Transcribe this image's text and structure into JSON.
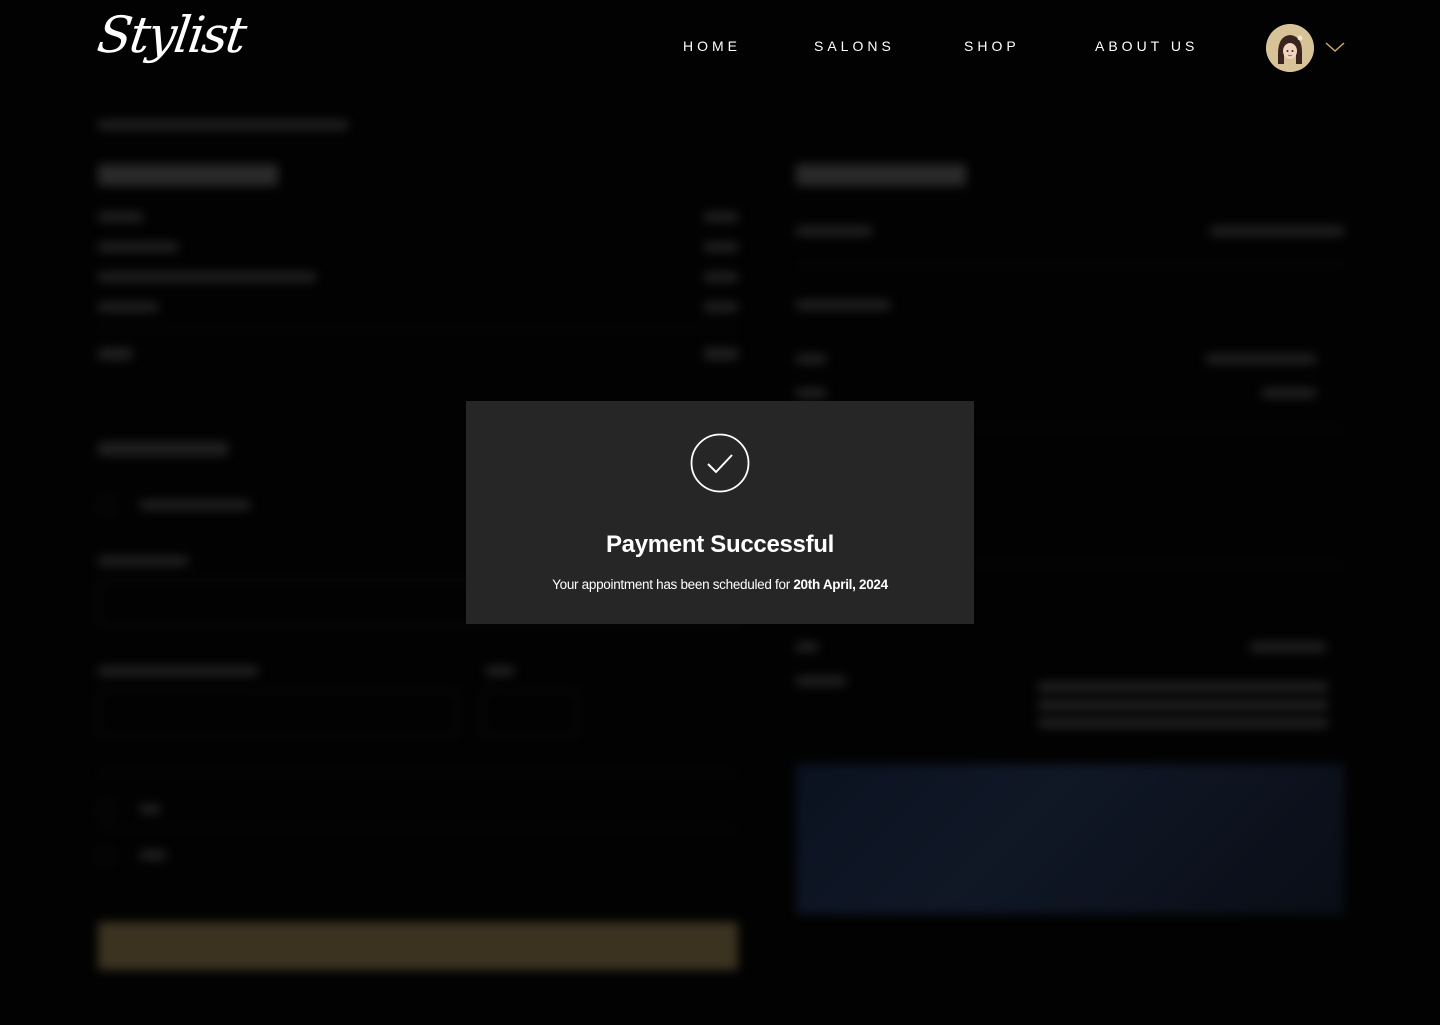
{
  "brand": {
    "logo_text": "Stylist"
  },
  "nav": {
    "items": [
      {
        "label": "HOME"
      },
      {
        "label": "SALONS"
      },
      {
        "label": "SHOP"
      },
      {
        "label": "ABOUT US"
      }
    ]
  },
  "user": {
    "avatar_icon": "user-avatar",
    "menu_icon": "chevron-down-icon"
  },
  "modal": {
    "icon": "check-circle-icon",
    "title": "Payment Successful",
    "message_prefix": "Your appointment has been scheduled for",
    "message_date": "20th April, 2024"
  },
  "colors": {
    "background": "#000000",
    "modal_background": "#262626",
    "accent_gold": "#6b5b3a"
  }
}
